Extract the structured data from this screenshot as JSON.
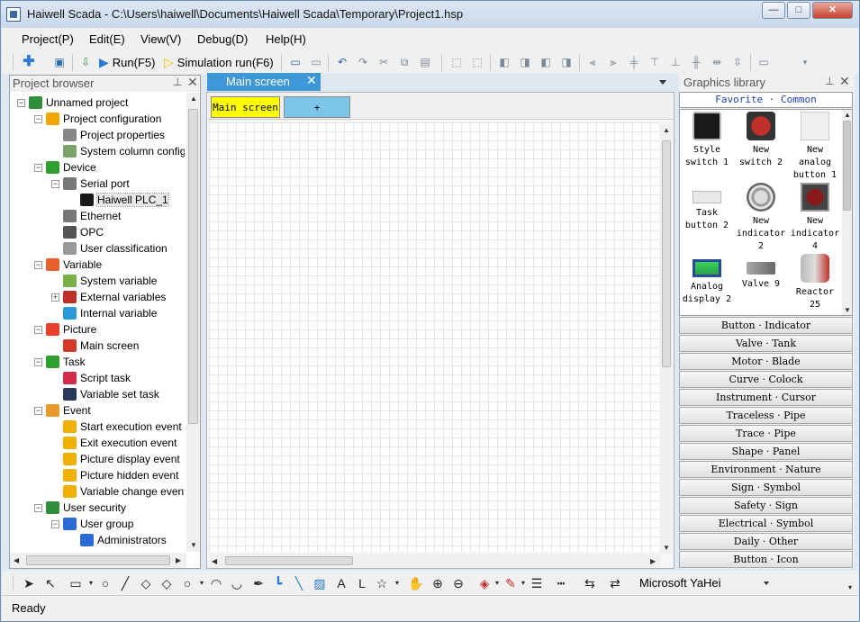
{
  "window": {
    "title": "Haiwell Scada - C:\\Users\\haiwell\\Documents\\Haiwell Scada\\Temporary\\Project1.hsp",
    "min_label": "—",
    "max_label": "□",
    "close_label": "✕"
  },
  "menu": [
    "Project(P)",
    "Edit(E)",
    "View(V)",
    "Debug(D)",
    "Help(H)"
  ],
  "toolbar": {
    "run_label": "Run(F5)",
    "simrun_label": "Simulation run(F6)"
  },
  "project_browser": {
    "title": "Project browser",
    "pin": "⊥",
    "close": "✕",
    "tree": [
      {
        "label": "Unnamed project",
        "icon": "project-icon",
        "color": "#2f8f3a",
        "expander": "−"
      },
      {
        "label": "Project configuration",
        "icon": "gear-icon",
        "color": "#f0a800",
        "expander": "−"
      },
      {
        "label": "Project properties",
        "icon": "properties-icon",
        "color": "#888888",
        "expander": ""
      },
      {
        "label": "System column configur",
        "icon": "column-icon",
        "color": "#7aa36a",
        "expander": ""
      },
      {
        "label": "Device",
        "icon": "device-icon",
        "color": "#2fa02f",
        "expander": "−"
      },
      {
        "label": "Serial port",
        "icon": "serial-icon",
        "color": "#777777",
        "expander": "−"
      },
      {
        "label": "Haiwell PLC_1",
        "icon": "plc-icon",
        "color": "#1a1a1a",
        "expander": ""
      },
      {
        "label": "Ethernet",
        "icon": "ethernet-icon",
        "color": "#777777",
        "expander": ""
      },
      {
        "label": "OPC",
        "icon": "opc-icon",
        "color": "#555555",
        "expander": ""
      },
      {
        "label": "User classification",
        "icon": "classification-icon",
        "color": "#999999",
        "expander": ""
      },
      {
        "label": "Variable",
        "icon": "variable-icon",
        "color": "#e8602c",
        "expander": "−"
      },
      {
        "label": "System variable",
        "icon": "system-variable-icon",
        "color": "#7ab04a",
        "expander": ""
      },
      {
        "label": "External variables",
        "icon": "external-variable-icon",
        "color": "#c0302a",
        "expander": "+"
      },
      {
        "label": "Internal variable",
        "icon": "internal-variable-icon",
        "color": "#2a9ad6",
        "expander": ""
      },
      {
        "label": "Picture",
        "icon": "picture-icon",
        "color": "#e8402c",
        "expander": "−"
      },
      {
        "label": "Main screen",
        "icon": "screen-icon",
        "color": "#d23c2c",
        "expander": ""
      },
      {
        "label": "Task",
        "icon": "task-icon",
        "color": "#2fa02f",
        "expander": "−"
      },
      {
        "label": "Script task",
        "icon": "script-icon",
        "color": "#d22c4c",
        "expander": ""
      },
      {
        "label": "Variable set task",
        "icon": "variable-set-icon",
        "color": "#2a3a5a",
        "expander": ""
      },
      {
        "label": "Event",
        "icon": "event-icon",
        "color": "#e89a2c",
        "expander": "−"
      },
      {
        "label": "Start execution event",
        "icon": "lightning-icon",
        "color": "#f0b000",
        "expander": ""
      },
      {
        "label": "Exit execution event",
        "icon": "lightning-icon",
        "color": "#f0b000",
        "expander": ""
      },
      {
        "label": "Picture display event",
        "icon": "lightning-icon",
        "color": "#f0b000",
        "expander": ""
      },
      {
        "label": "Picture hidden event",
        "icon": "lightning-icon",
        "color": "#f0b000",
        "expander": ""
      },
      {
        "label": "Variable change event",
        "icon": "lightning-icon",
        "color": "#f0b000",
        "expander": ""
      },
      {
        "label": "User security",
        "icon": "users-icon",
        "color": "#2f8f3a",
        "expander": "−"
      },
      {
        "label": "User group",
        "icon": "user-group-icon",
        "color": "#2a6ad6",
        "expander": "−"
      },
      {
        "label": "Administrators",
        "icon": "admins-icon",
        "color": "#2a6ad6",
        "expander": ""
      }
    ]
  },
  "editor": {
    "tab_label": "Main screen",
    "tab_close": "✕",
    "page_tab": "Main screen",
    "add_tab": "+"
  },
  "graphics_library": {
    "title": "Graphics library",
    "pin": "⊥",
    "close": "✕",
    "favorite": "Favorite · Common",
    "items": [
      {
        "label": "Style switch 1",
        "icon": "toggle-switch-icon"
      },
      {
        "label": "New switch 2",
        "icon": "red-button-icon"
      },
      {
        "label": "New analog button 1",
        "icon": "analog-button-icon"
      },
      {
        "label": "Task button 2",
        "icon": "task-button-icon"
      },
      {
        "label": "New indicator 2",
        "icon": "round-indicator-icon"
      },
      {
        "label": "New indicator 4",
        "icon": "square-indicator-icon"
      },
      {
        "label": "Analog display 2",
        "icon": "analog-display-icon"
      },
      {
        "label": "Valve 9",
        "icon": "valve-icon"
      },
      {
        "label": "Reactor 25",
        "icon": "reactor-icon"
      }
    ],
    "categories": [
      "Button · Indicator",
      "Valve · Tank",
      "Motor · Blade",
      "Curve · Colock",
      "Instrument · Cursor",
      "Traceless · Pipe",
      "Trace · Pipe",
      "Shape · Panel",
      "Environment · Nature",
      "Sign · Symbol",
      "Safety · Sign",
      "Electrical · Symbol",
      "Daily · Other",
      "Button · Icon"
    ]
  },
  "font_selector": {
    "value": "Microsoft YaHei"
  },
  "status": {
    "text": "Ready"
  }
}
